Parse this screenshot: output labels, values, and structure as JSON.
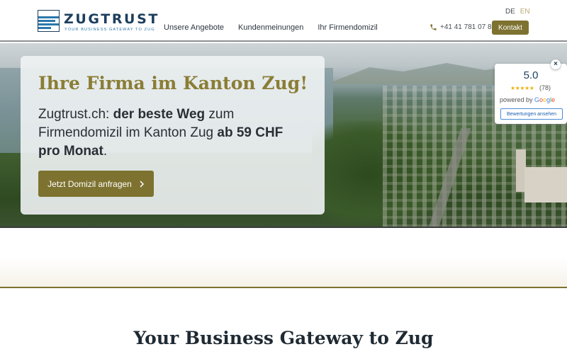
{
  "brand": {
    "name": "ZUGTRUST",
    "tagline": "YOUR BUSINESS GATEWAY TO ZUG",
    "primary_color": "#7d7230",
    "logo_color": "#1d3e5d"
  },
  "nav": {
    "items": [
      {
        "label": "Unsere Angebote"
      },
      {
        "label": "Kundenmeinungen"
      },
      {
        "label": "Ihr Firmendomizil"
      }
    ]
  },
  "language": {
    "active": "DE",
    "other": "EN"
  },
  "contact": {
    "phone_icon": "phone-icon",
    "phone": "+41 41 781 07 81",
    "button_label": "Kontakt"
  },
  "hero": {
    "title": "Ihre Firma im Kanton Zug!",
    "text_1": "Zugtrust.ch: ",
    "text_2": "der beste Weg",
    "text_3": " zum Firmendomizil im Kanton Zug ",
    "text_4": "ab 59 CHF pro Monat",
    "text_5": ".",
    "cta_label": "Jetzt Domizil anfragen",
    "cta_icon": "chevron-right-icon"
  },
  "google_widget": {
    "close": "×",
    "score": "5.0",
    "stars": "★★★★★",
    "count": "(78)",
    "powered_by": "powered by ",
    "google": [
      "G",
      "o",
      "o",
      "g",
      "l",
      "e"
    ],
    "button_label": "Bewertungen ansehen"
  },
  "section": {
    "title": "Your Business Gateway to Zug"
  }
}
